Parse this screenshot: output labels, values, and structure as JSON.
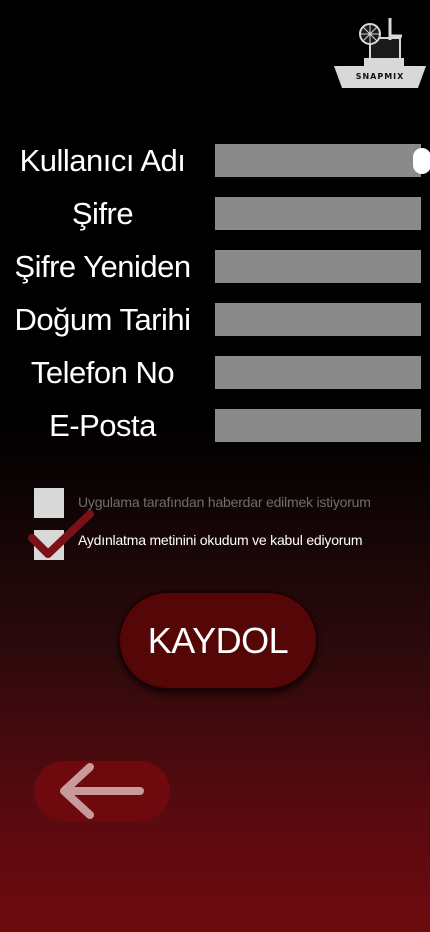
{
  "logo": {
    "text": "SNAPMIX"
  },
  "form": {
    "fields": [
      {
        "label": "Kullanıcı Adı",
        "value": "",
        "placeholder": ""
      },
      {
        "label": "Şifre",
        "value": "",
        "placeholder": ""
      },
      {
        "label": "Şifre Yeniden",
        "value": "",
        "placeholder": ""
      },
      {
        "label": "Doğum Tarihi",
        "value": "",
        "placeholder": ""
      },
      {
        "label": "Telefon No",
        "value": "",
        "placeholder": ""
      },
      {
        "label": "E-Posta",
        "value": "",
        "placeholder": ""
      }
    ]
  },
  "checkboxes": [
    {
      "label": "Uygulama tarafından haberdar edilmek istiyorum",
      "checked": false
    },
    {
      "label": "Aydınlatma metinini okudum ve kabul ediyorum",
      "checked": true
    }
  ],
  "register_button": {
    "label": "KAYDOL"
  },
  "back_button": {
    "icon": "arrow-left-icon"
  },
  "colors": {
    "accent": "#6e0a0e",
    "button": "#550708",
    "input_bg": "#8a8a8a",
    "checkbox_bg": "#d9d9d9",
    "checkmark": "#7a1116"
  }
}
